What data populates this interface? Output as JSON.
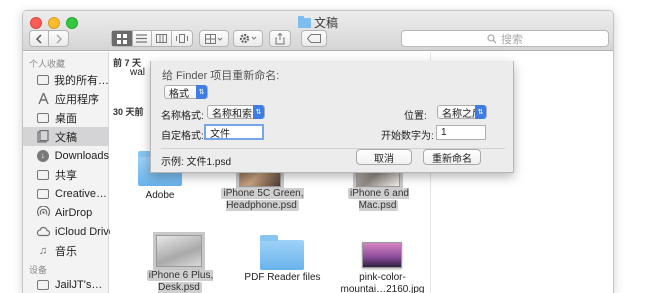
{
  "window": {
    "title": "文稿"
  },
  "toolbar": {
    "back_icon": "chevron-left-icon",
    "forward_icon": "chevron-right-icon",
    "search_placeholder": "搜索"
  },
  "sidebar": {
    "favorites_header": "个人收藏",
    "favorites": [
      {
        "label": "我的所有…",
        "icon": "all-files-icon"
      },
      {
        "label": "应用程序",
        "icon": "applications-icon"
      },
      {
        "label": "桌面",
        "icon": "desktop-icon"
      },
      {
        "label": "文稿",
        "icon": "documents-icon",
        "selected": true
      },
      {
        "label": "Downloads",
        "icon": "downloads-icon"
      },
      {
        "label": "共享",
        "icon": "shared-folder-icon"
      },
      {
        "label": "Creative…",
        "icon": "folder-icon"
      },
      {
        "label": "AirDrop",
        "icon": "airdrop-icon"
      },
      {
        "label": "iCloud Drive",
        "icon": "icloud-icon"
      },
      {
        "label": "音乐",
        "icon": "music-icon"
      }
    ],
    "devices_header": "设备",
    "devices": [
      {
        "label": "JailJT's…",
        "icon": "computer-icon"
      }
    ]
  },
  "content": {
    "group_7days": "前 7 天",
    "partial_item": "wal",
    "group_30days": "30 天前",
    "files": [
      {
        "label": "Adobe",
        "kind": "folder",
        "selected": false
      },
      {
        "label": "iPhone 5C Green,\nHeadphone.psd",
        "kind": "image",
        "selected": true
      },
      {
        "label": "iPhone 6 and\nMac.psd",
        "kind": "image",
        "selected": true
      },
      {
        "label": "iPhone 6 Plus,\nDesk.psd",
        "kind": "image",
        "selected": true
      },
      {
        "label": "PDF Reader files",
        "kind": "folder",
        "selected": false
      },
      {
        "label": "pink-color-\nmountai…2160.jpg",
        "kind": "image",
        "selected": false
      }
    ]
  },
  "rename_sheet": {
    "title": "给 Finder 项目重新命名:",
    "mode": "格式",
    "name_format_label": "名称格式:",
    "name_format_value": "名称和索引",
    "position_label": "位置:",
    "position_value": "名称之后",
    "custom_format_label": "自定格式:",
    "custom_format_value": "文件",
    "start_number_label": "开始数字为:",
    "start_number_value": "1",
    "example_text": "示例:  文件1.psd",
    "cancel_label": "取消",
    "rename_label": "重新命名"
  },
  "colors": {
    "accent": "#3e7de3",
    "folder": "#7cbef0",
    "selection": "#d4d4d6"
  }
}
